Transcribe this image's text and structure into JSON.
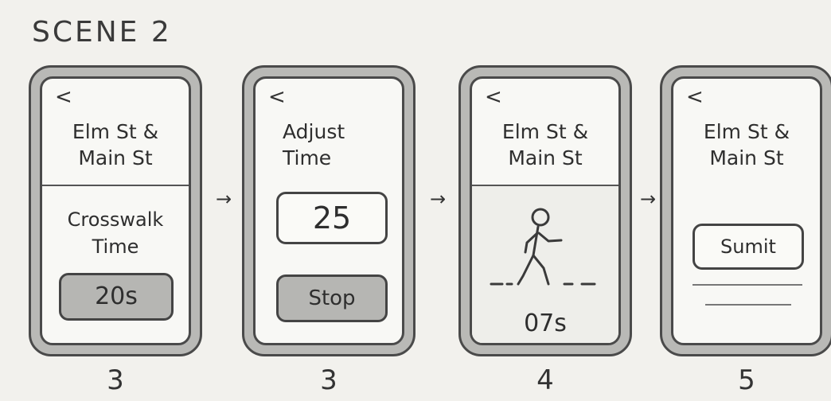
{
  "scene_title": "SCENE 2",
  "arrow_glyph": "→",
  "screens": [
    {
      "back": "<",
      "header_lines": [
        "Elm St &",
        "Main St"
      ],
      "label_lines": [
        "Crosswalk",
        "Time"
      ],
      "button": "20s",
      "step": "3"
    },
    {
      "back": "<",
      "header_lines": [
        "Adjust",
        "Time"
      ],
      "value": "25",
      "button": "Stop",
      "step": "3"
    },
    {
      "back": "<",
      "header_lines": [
        "Elm St &",
        "Main St"
      ],
      "icon": "pedestrian-walking-icon",
      "countdown": "07s",
      "step": "4"
    },
    {
      "back": "<",
      "header_lines": [
        "Elm St &",
        "Main St"
      ],
      "button": "Sumit",
      "step": "5"
    }
  ]
}
